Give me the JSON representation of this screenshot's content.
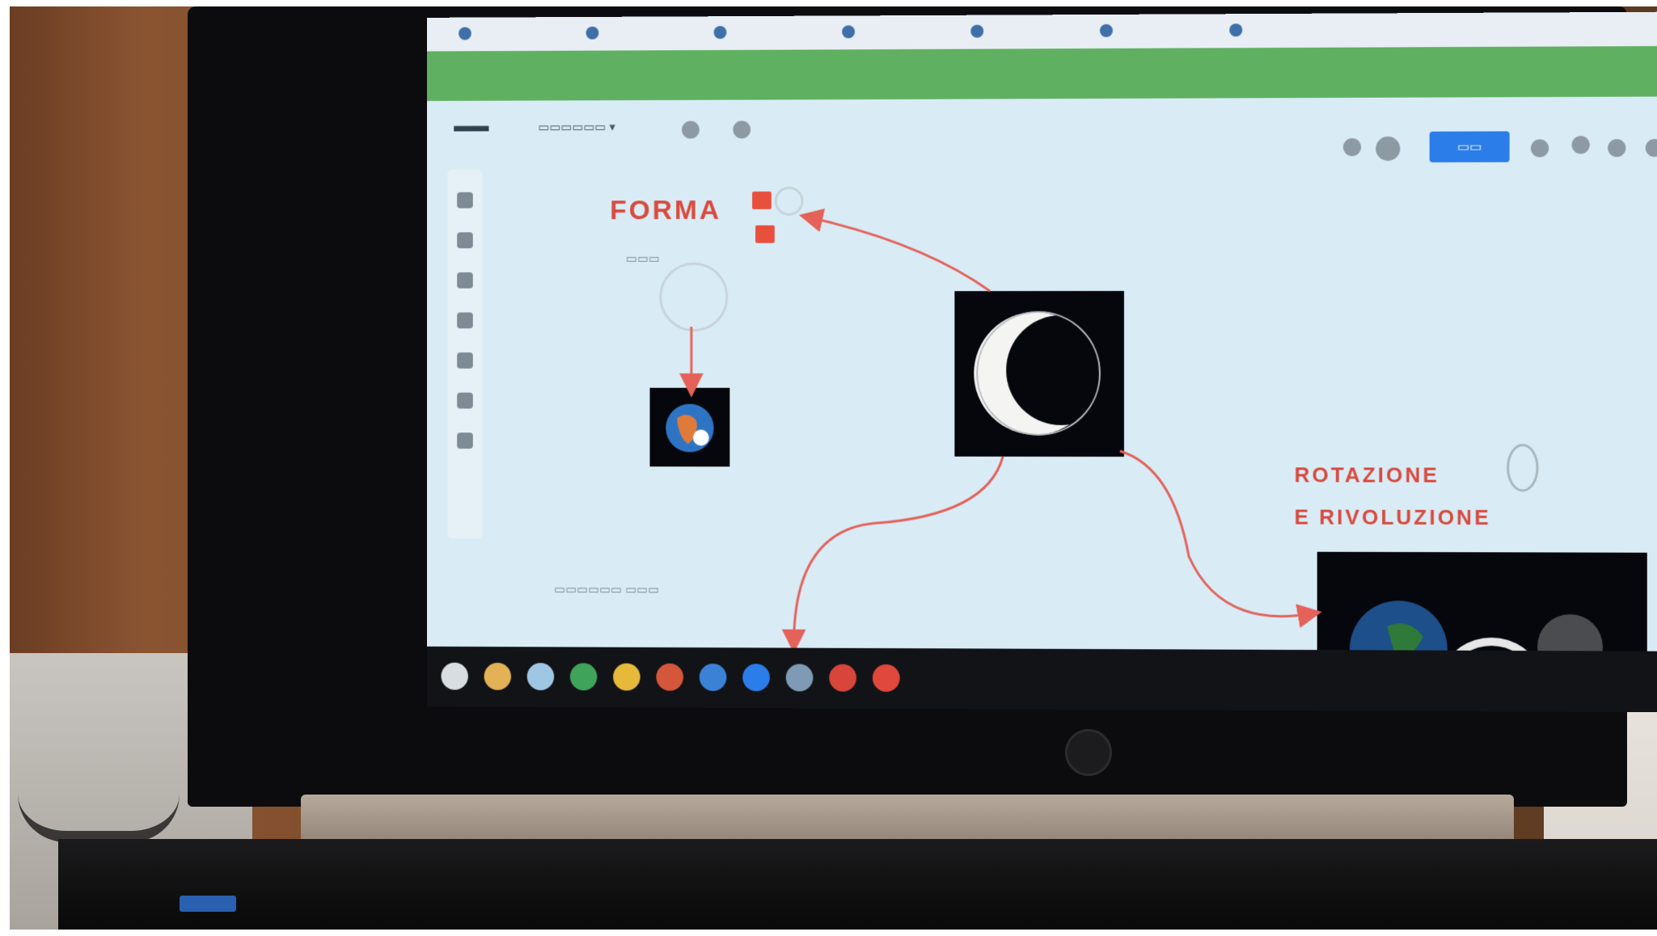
{
  "canvas": {
    "labels": {
      "forma": "FORMA",
      "rotazione_line1": "ROTAZIONE",
      "rotazione_line2": "E RIVOLUZIONE"
    }
  },
  "toolbar": {
    "share_button_color": "#2b7de9"
  },
  "colors": {
    "accent_red": "#d94a3e",
    "banner_green": "#4aa646",
    "canvas_background": "#d9ecf6",
    "taskbar": "#121317"
  },
  "icons": {
    "sticky_notes": "sticky-note-icon",
    "moon": "moon-phase-icon",
    "earth": "earth-icon",
    "play": "play-icon"
  }
}
